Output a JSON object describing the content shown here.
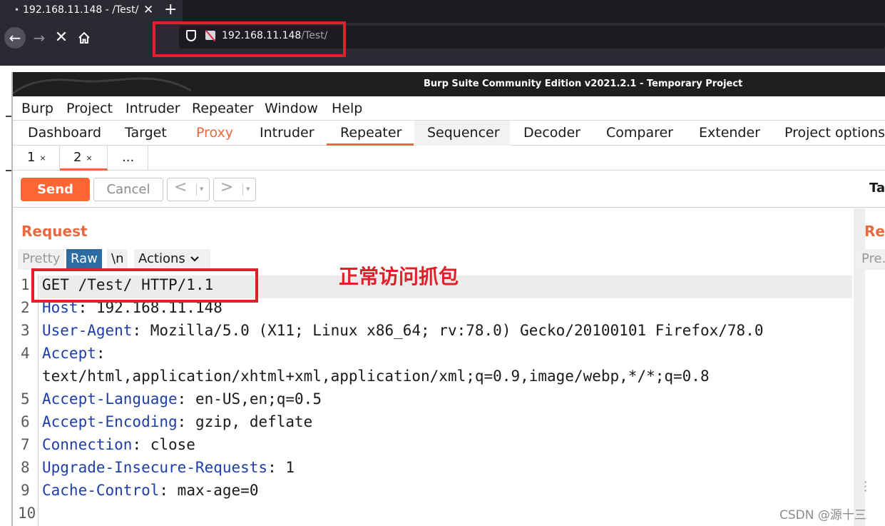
{
  "browser": {
    "tab_title": "192.168.11.148 - /Test/",
    "tab_close": "✕",
    "new_tab": "+",
    "url_host": "192.168.11.148",
    "url_path": "/Test/"
  },
  "burp": {
    "window_title": "Burp Suite Community Edition v2021.2.1 - Temporary Project",
    "menu": [
      "Burp",
      "Project",
      "Intruder",
      "Repeater",
      "Window",
      "Help"
    ],
    "tools": [
      "Dashboard",
      "Target",
      "Proxy",
      "Intruder",
      "Repeater",
      "Sequencer",
      "Decoder",
      "Comparer",
      "Extender",
      "Project options"
    ],
    "active_tool": "Repeater",
    "subtabs": [
      {
        "label": "1",
        "close": "×"
      },
      {
        "label": "2",
        "close": "×"
      },
      {
        "label": "...",
        "close": ""
      }
    ],
    "send_label": "Send",
    "cancel_label": "Cancel",
    "back_label": "<",
    "forward_label": ">",
    "dropdown_caret": "▾",
    "right_truncated": "Ta",
    "request": {
      "title": "Request",
      "view_tabs": [
        "Pretty",
        "Raw",
        "\\n",
        "Actions"
      ],
      "active_view": "Raw",
      "lines": [
        {
          "num": "1",
          "key": "",
          "sep": "",
          "value": "GET /Test/ HTTP/1.1"
        },
        {
          "num": "2",
          "key": "Host",
          "sep": ":",
          "value": " 192.168.11.148"
        },
        {
          "num": "3",
          "key": "User-Agent",
          "sep": ":",
          "value": " Mozilla/5.0 (X11; Linux x86_64; rv:78.0) Gecko/20100101 Firefox/78.0"
        },
        {
          "num": "4",
          "key": "Accept",
          "sep": ":",
          "value": ""
        },
        {
          "num": "",
          "key": "",
          "sep": "",
          "value": "text/html,application/xhtml+xml,application/xml;q=0.9,image/webp,*/*;q=0.8"
        },
        {
          "num": "5",
          "key": "Accept-Language",
          "sep": ":",
          "value": " en-US,en;q=0.5"
        },
        {
          "num": "6",
          "key": "Accept-Encoding",
          "sep": ":",
          "value": " gzip, deflate"
        },
        {
          "num": "7",
          "key": "Connection",
          "sep": ":",
          "value": " close"
        },
        {
          "num": "8",
          "key": "Upgrade-Insecure-Requests",
          "sep": ":",
          "value": " 1"
        },
        {
          "num": "9",
          "key": "Cache-Control",
          "sep": ":",
          "value": " max-age=0"
        },
        {
          "num": "10",
          "key": "",
          "sep": "",
          "value": ""
        }
      ]
    },
    "response": {
      "title_truncated": "Res",
      "view_truncated": "Pre..."
    }
  },
  "annotation": "正常访问抓包",
  "watermark": "CSDN @源十三",
  "colors": {
    "accent": "#e8683f",
    "send": "#ff6633",
    "annotation": "#e0202a",
    "header_key": "#1f3ea8",
    "active_view": "#2d6ca3"
  }
}
